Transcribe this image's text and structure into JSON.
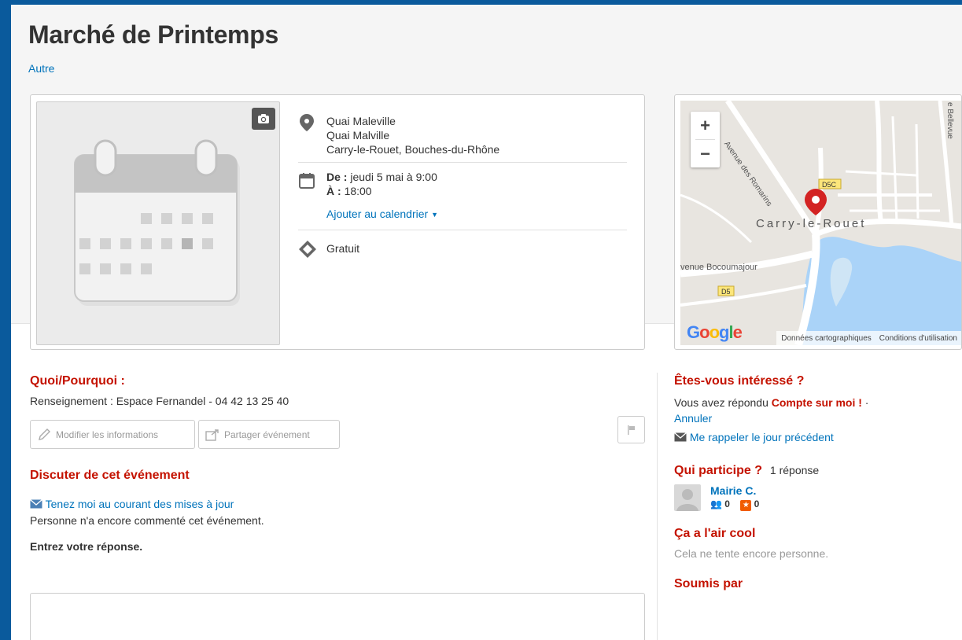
{
  "header": {
    "title": "Marché de Printemps",
    "category": "Autre"
  },
  "event": {
    "address_lines": [
      "Quai Maleville",
      "Quai Malville",
      "Carry-le-Rouet, Bouches-du-Rhône"
    ],
    "from_label": "De :",
    "from_value": "jeudi 5 mai à 9:00",
    "to_label": "À :",
    "to_value": "18:00",
    "add_calendar": "Ajouter au calendrier",
    "price": "Gratuit"
  },
  "map": {
    "zoom_in": "+",
    "zoom_out": "−",
    "labels": {
      "street1": "Avenue des Romarins",
      "street2": "venue Bocoumajour",
      "street3": "e Bellevue",
      "town": "Carry-le-Rouet",
      "road1": "D5C",
      "road2": "D5"
    },
    "google": "Google",
    "map_data": "Données cartographiques",
    "terms": "Conditions d'utilisation"
  },
  "what": {
    "title": "Quoi/Pourquoi :",
    "text": "Renseignement : Espace Fernandel - 04 42 13 25 40",
    "edit_button": "Modifier les informations",
    "share_button": "Partager événement"
  },
  "discuss": {
    "title": "Discuter de cet événement",
    "subscribe": "Tenez moi au courant des mises à jour",
    "no_comments": "Personne n'a encore commenté cet événement.",
    "prompt": "Entrez votre réponse."
  },
  "interest": {
    "title": "Êtes-vous intéressé ?",
    "answered_prefix": "Vous avez répondu",
    "answer": "Compte sur moi !",
    "separator": "·",
    "cancel": "Annuler",
    "remind": "Me rappeler le jour précédent"
  },
  "attendees": {
    "title": "Qui participe ?",
    "count": "1 réponse",
    "people": [
      {
        "name": "Mairie C.",
        "friends": "0",
        "reviews": "0"
      }
    ]
  },
  "cool": {
    "title": "Ça a l'air cool",
    "text": "Cela ne tente encore personne."
  },
  "submitted": {
    "title": "Soumis par"
  },
  "colors": {
    "brand_red": "#c41200",
    "link_blue": "#0073bb",
    "frame_blue": "#0a5a9c"
  }
}
